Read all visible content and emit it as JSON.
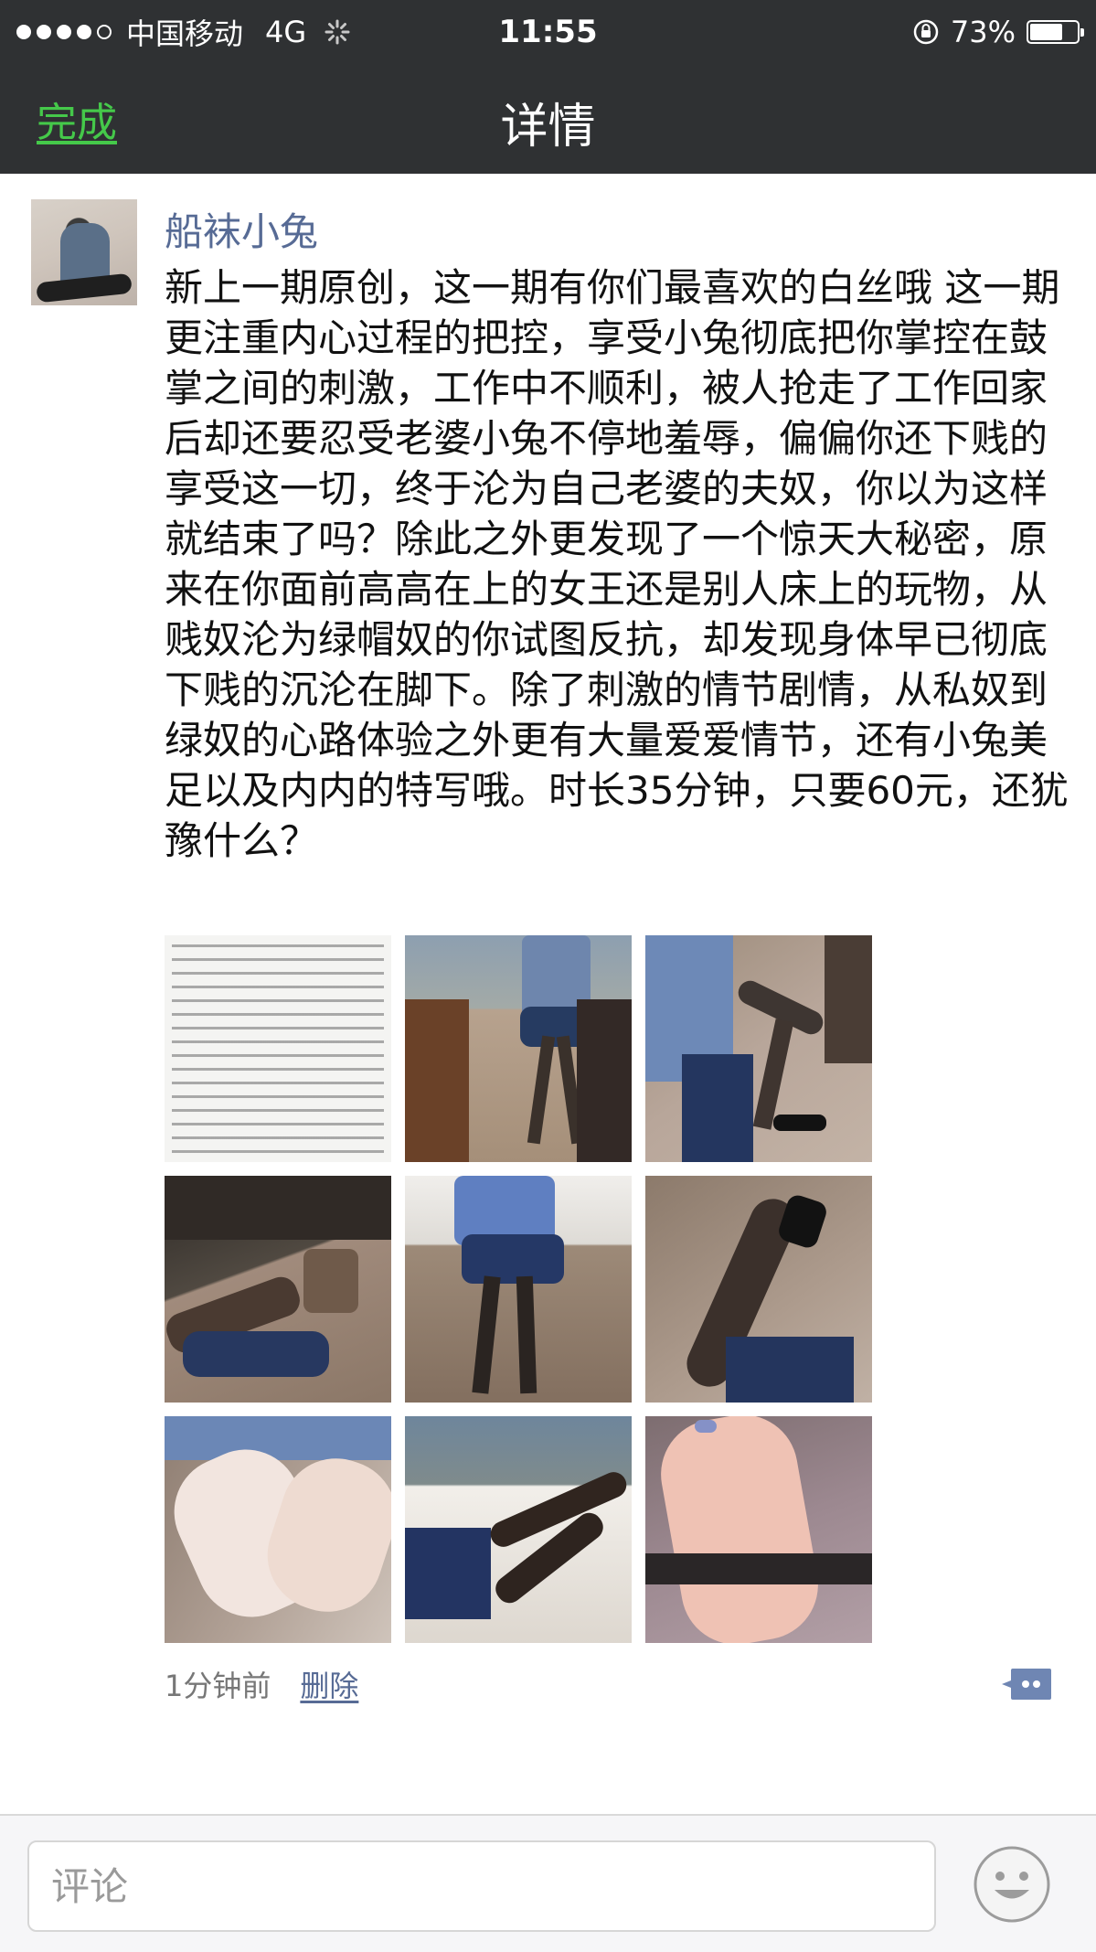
{
  "status_bar": {
    "carrier": "中国移动",
    "network": "4G",
    "time": "11:55",
    "battery_percent": "73%",
    "battery_level": 0.73,
    "signal_strength": 4,
    "signal_max": 5
  },
  "nav": {
    "done_label": "完成",
    "title": "详情"
  },
  "post": {
    "nickname": "船袜小兔",
    "content": "新上一期原创，这一期有你们最喜欢的白丝哦  这一期更注重内心过程的把控，享受小兔彻底把你掌控在鼓掌之间的刺激，工作中不顺利，被人抢走了工作回家后却还要忍受老婆小兔不停地羞辱，偏偏你还下贱的享受这一切，终于沦为自己老婆的夫奴，你以为这样就结束了吗？除此之外更发现了一个惊天大秘密，原来在你面前高高在上的女王还是别人床上的玩物，从贱奴沦为绿帽奴的你试图反抗，却发现身体早已彻底下贱的沉沦在脚下。除了刺激的情节剧情，从私奴到绿奴的心路体验之外更有大量爱爱情节，还有小兔美足以及内内的特写哦。时长35分钟，只要60元，还犹豫什么？",
    "timestamp": "1分钟前",
    "delete_label": "删除"
  },
  "comment_bar": {
    "placeholder": "评论"
  },
  "colors": {
    "top_bar": "#2f3133",
    "done_green": "#45c94a",
    "link_blue": "#576b95",
    "text": "#111111",
    "muted": "#777777"
  },
  "icons": {
    "signal": "signal-dots-icon",
    "loading": "loading-spinner-icon",
    "rotation_lock": "rotation-lock-icon",
    "battery": "battery-icon",
    "comment": "comment-bubble-icon",
    "emoji": "emoji-smile-icon"
  }
}
